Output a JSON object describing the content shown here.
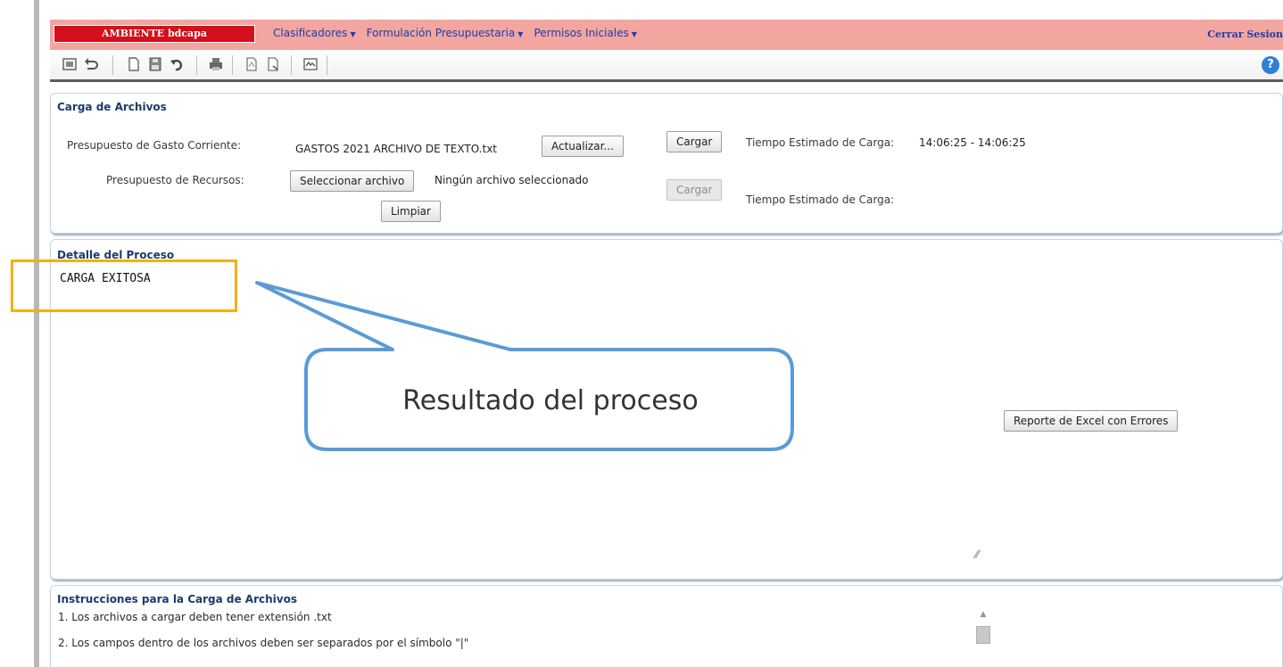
{
  "header": {
    "environment": "AMBIENTE bdcapa",
    "menu": [
      {
        "label": "Clasificadores"
      },
      {
        "label": "Formulación Presupuestaria"
      },
      {
        "label": "Permisos Iniciales"
      }
    ],
    "logout": "Cerrar Sesion"
  },
  "toolbar": {
    "icons": [
      "home-icon",
      "undo-icon",
      "new-document-icon",
      "save-icon",
      "refresh-icon",
      "print-icon",
      "pdf-icon",
      "export-icon",
      "view-icon",
      "help-icon"
    ],
    "help_glyph": "?"
  },
  "carga": {
    "title": "Carga de Archivos",
    "gasto_label": "Presupuesto de Gasto Corriente:",
    "gasto_file": "GASTOS 2021 ARCHIVO DE TEXTO.txt",
    "actualizar_label": "Actualizar...",
    "cargar_label_1": "Cargar",
    "tiempo_label_1": "Tiempo Estimado de Carga:",
    "tiempo_value_1": "14:06:25 - 14:06:25",
    "recursos_label": "Presupuesto de Recursos:",
    "select_file_label": "Seleccionar archivo",
    "no_file_text": "Ningún archivo seleccionado",
    "cargar_label_2": "Cargar",
    "tiempo_label_2": "Tiempo Estimado de Carga:",
    "limpiar_label": "Limpiar"
  },
  "detalle": {
    "title": "Detalle del Proceso",
    "result": "CARGA EXITOSA",
    "excel_report_label": "Reporte de Excel con Errores"
  },
  "callout": {
    "text": "Resultado del proceso",
    "highlight_color": "#f2b10c",
    "callout_color": "#5b9bd5"
  },
  "instrucciones": {
    "title": "Instrucciones para la Carga de Archivos",
    "items": [
      "1. Los archivos a cargar deben tener extensión .txt",
      "2. Los campos dentro de los archivos deben ser separados por el símbolo \"|\""
    ]
  },
  "colors": {
    "header_bg": "#f3a5a0",
    "env_badge_bg": "#d3101c",
    "menu_link": "#1a3fb0",
    "panel_title": "#1b3b6b"
  }
}
